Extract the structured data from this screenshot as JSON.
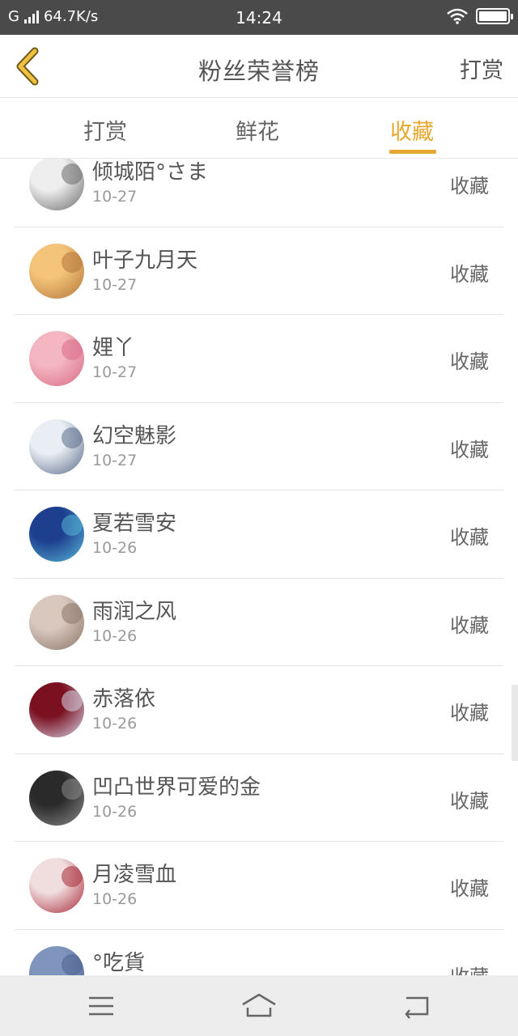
{
  "status_bar": {
    "carrier": "G",
    "speed": "64.7K/s",
    "time": "14:24",
    "battery_level": 0.95
  },
  "header": {
    "title": "粉丝荣誉榜",
    "right_action": "打赏",
    "back_icon": "chevron-left-icon"
  },
  "tabs": [
    {
      "label": "打赏",
      "active": false
    },
    {
      "label": "鲜花",
      "active": false
    },
    {
      "label": "收藏",
      "active": true
    }
  ],
  "colors": {
    "accent": "#e6a82e",
    "status_bar": "#4a4a4a",
    "divider": "#e4e4e4"
  },
  "list": [
    {
      "name": "倾城陌°さま",
      "date": "10-27",
      "action": "收藏",
      "avatar": [
        "#eeeeee",
        "#6a6a6a"
      ]
    },
    {
      "name": "叶子九月天",
      "date": "10-27",
      "action": "收藏",
      "avatar": [
        "#f3c47a",
        "#b5743a"
      ]
    },
    {
      "name": "娌丫",
      "date": "10-27",
      "action": "收藏",
      "avatar": [
        "#f4b7c2",
        "#d86a86"
      ]
    },
    {
      "name": "幻空魅影",
      "date": "10-27",
      "action": "收藏",
      "avatar": [
        "#e8eef4",
        "#5a6a88"
      ]
    },
    {
      "name": "夏若雪安",
      "date": "10-26",
      "action": "收藏",
      "avatar": [
        "#1d3f8e",
        "#58b8d8"
      ]
    },
    {
      "name": "雨润之风",
      "date": "10-26",
      "action": "收藏",
      "avatar": [
        "#d8c8be",
        "#8a7468"
      ]
    },
    {
      "name": "赤落依",
      "date": "10-26",
      "action": "收藏",
      "avatar": [
        "#7a1020",
        "#d8d8ea"
      ]
    },
    {
      "name": "凹凸世界可爱的金",
      "date": "10-26",
      "action": "收藏",
      "avatar": [
        "#2a2a2a",
        "#8a8a8a"
      ]
    },
    {
      "name": "月凌雪血",
      "date": "10-26",
      "action": "收藏",
      "avatar": [
        "#f0dede",
        "#a82838"
      ]
    },
    {
      "name": "°吃貨",
      "date": "",
      "action": "收藏",
      "avatar": [
        "#7f95bd",
        "#4c6290"
      ]
    }
  ],
  "nav_bar": {
    "items": [
      "menu-icon",
      "home-icon",
      "back-icon"
    ]
  }
}
